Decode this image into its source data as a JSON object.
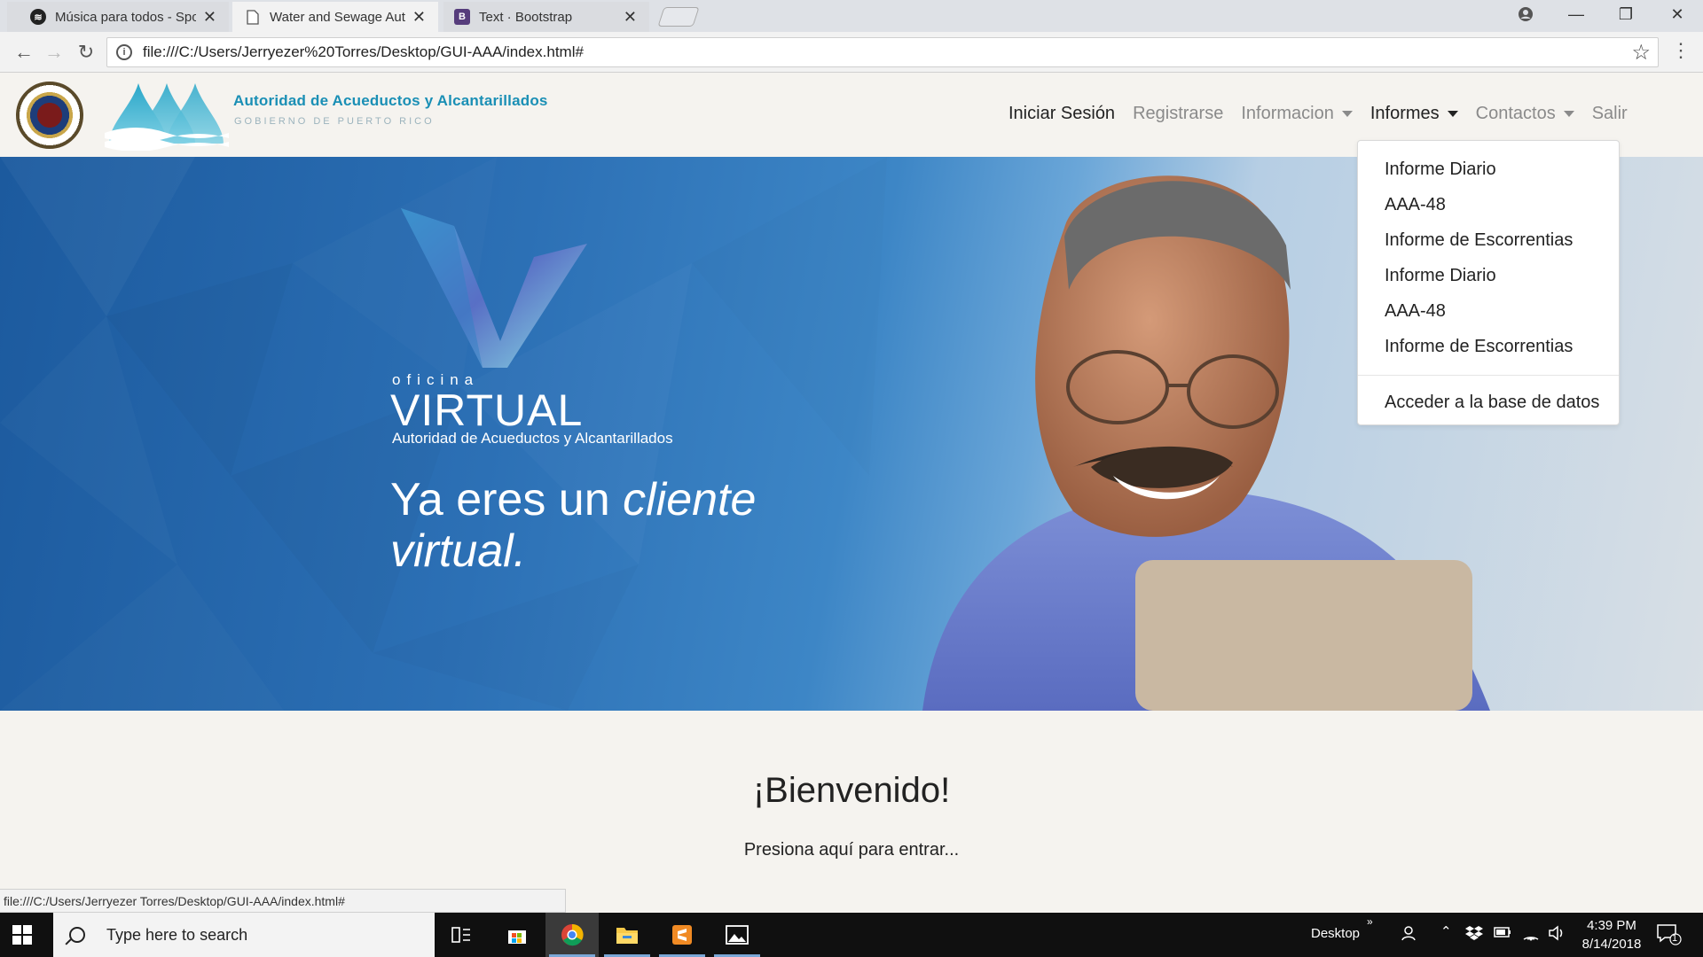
{
  "browser": {
    "tabs": [
      {
        "title": "Música para todos - Spotify",
        "favicon": "spotify-icon"
      },
      {
        "title": "Water and Sewage Authority",
        "favicon": "page-icon"
      },
      {
        "title": "Text · Bootstrap",
        "favicon": "bootstrap-icon",
        "favicon_letter": "B"
      }
    ],
    "active_tab": 1,
    "url": "file:///C:/Users/Jerryezer%20Torres/Desktop/GUI-AAA/index.html#",
    "status_url": "file:///C:/Users/Jerryezer Torres/Desktop/GUI-AAA/index.html#"
  },
  "site": {
    "brand_title": "Autoridad de Acueductos y Alcantarillados",
    "brand_subtitle": "GOBIERNO DE PUERTO RICO",
    "nav": [
      {
        "label": "Iniciar Sesión",
        "dropdown": false
      },
      {
        "label": "Registrarse",
        "dropdown": false
      },
      {
        "label": "Informacion",
        "dropdown": true
      },
      {
        "label": "Informes",
        "dropdown": true,
        "open": true
      },
      {
        "label": "Contactos",
        "dropdown": true
      },
      {
        "label": "Salir",
        "dropdown": false
      }
    ],
    "informes_menu": {
      "items": [
        "Informe Diario",
        "AAA-48",
        "Informe de Escorrentias",
        "Informe Diario",
        "AAA-48",
        "Informe de Escorrentias"
      ],
      "footer_item": "Acceder a la base de datos"
    },
    "hero": {
      "oficina": "oficina",
      "virtual": "VIRTUAL",
      "subtitle": "Autoridad de Acueductos y Alcantarillados",
      "tagline_plain": "Ya eres un ",
      "tagline_italic": "cliente virtual."
    },
    "welcome": "¡Bienvenido!",
    "enter_text": "Presiona aquí para entrar..."
  },
  "taskbar": {
    "search_placeholder": "Type here to search",
    "desktop_label": "Desktop",
    "time": "4:39 PM",
    "date": "8/14/2018",
    "notification_count": "1"
  },
  "colors": {
    "brand": "#1a8fb5",
    "nav_muted": "#8a8a8a",
    "page_bg": "#f5f3ef"
  }
}
